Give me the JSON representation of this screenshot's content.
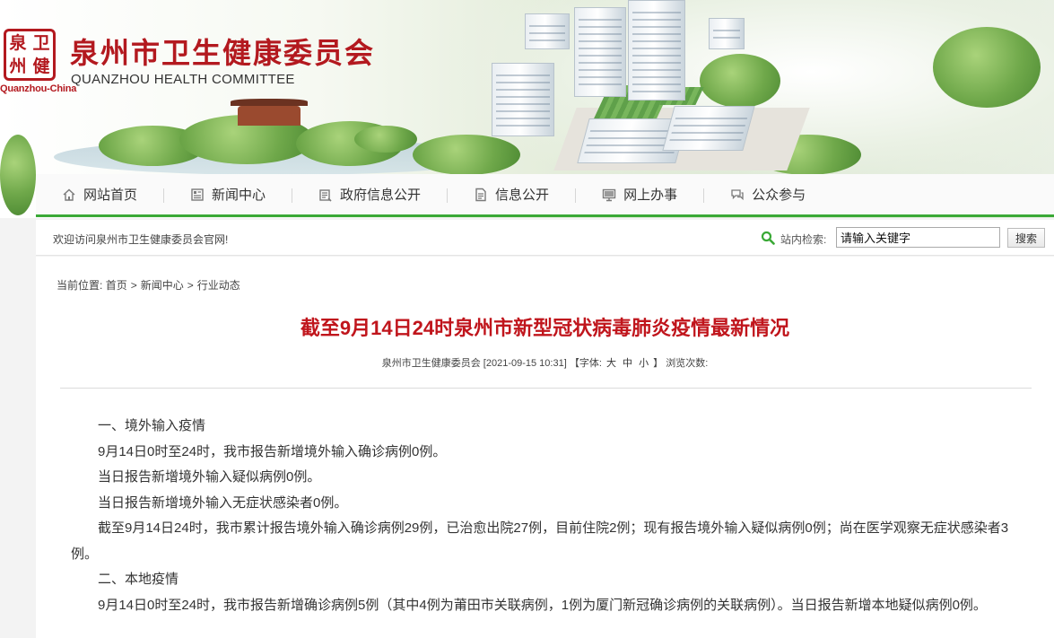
{
  "header": {
    "seal_chars": [
      "泉",
      "卫",
      "州",
      "健"
    ],
    "seal_tag": "Quanzhou-China",
    "title": "泉州市卫生健康委员会",
    "subtitle": "QUANZHOU HEALTH COMMITTEE"
  },
  "nav": {
    "items": [
      {
        "label": "网站首页",
        "icon": "home-icon"
      },
      {
        "label": "新闻中心",
        "icon": "news-icon"
      },
      {
        "label": "政府信息公开",
        "icon": "document-icon"
      },
      {
        "label": "信息公开",
        "icon": "file-list-icon"
      },
      {
        "label": "网上办事",
        "icon": "monitor-icon"
      },
      {
        "label": "公众参与",
        "icon": "chat-icon"
      }
    ],
    "accent_color": "#3aa936"
  },
  "welcome": {
    "text": "欢迎访问泉州市卫生健康委员会官网!",
    "search_label": "站内检索:",
    "search_value": "请输入关键字",
    "search_button": "搜索"
  },
  "breadcrumb": {
    "prefix": "当前位置:",
    "items": [
      "首页",
      "新闻中心",
      "行业动态"
    ],
    "separator": ">"
  },
  "article": {
    "title": "截至9月14日24时泉州市新型冠状病毒肺炎疫情最新情况",
    "title_color": "#c0151c",
    "meta": {
      "source": "泉州市卫生健康委员会",
      "date": "[2021-09-15 10:31]",
      "font_label": "【字体:",
      "font_large": "大",
      "font_medium": "中",
      "font_small": "小",
      "font_close": "】",
      "views_label": "浏览次数:"
    },
    "paragraphs": [
      "一、境外输入疫情",
      "9月14日0时至24时，我市报告新增境外输入确诊病例0例。",
      "当日报告新增境外输入疑似病例0例。",
      "当日报告新增境外输入无症状感染者0例。",
      "截至9月14日24时，我市累计报告境外输入确诊病例29例，已治愈出院27例，目前住院2例；现有报告境外输入疑似病例0例；尚在医学观察无症状感染者3例。",
      "二、本地疫情",
      "9月14日0时至24时，我市报告新增确诊病例5例（其中4例为莆田市关联病例，1例为厦门新冠确诊病例的关联病例）。当日报告新增本地疑似病例0例。"
    ]
  }
}
